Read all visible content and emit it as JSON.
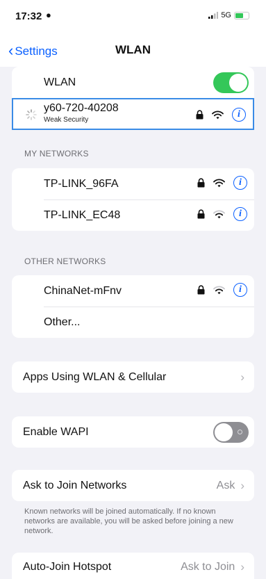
{
  "status": {
    "time": "17:32",
    "network": "5G"
  },
  "nav": {
    "back_label": "Settings",
    "title": "WLAN"
  },
  "wlan": {
    "label": "WLAN",
    "enabled": true
  },
  "joining": {
    "name": "y60-720-40208",
    "subtitle": "Weak Security"
  },
  "my_networks": {
    "header": "MY NETWORKS",
    "items": [
      {
        "name": "TP-LINK_96FA"
      },
      {
        "name": "TP-LINK_EC48"
      }
    ]
  },
  "other_networks": {
    "header": "OTHER NETWORKS",
    "items": [
      {
        "name": "ChinaNet-mFnv"
      }
    ],
    "other_label": "Other..."
  },
  "apps_using": {
    "label": "Apps Using WLAN & Cellular"
  },
  "wapi": {
    "label": "Enable WAPI",
    "enabled": false
  },
  "ask_to_join": {
    "label": "Ask to Join Networks",
    "value": "Ask",
    "footer": "Known networks will be joined automatically. If no known networks are available, you will be asked before joining a new network."
  },
  "auto_join_hotspot": {
    "label": "Auto-Join Hotspot",
    "value": "Ask to Join"
  },
  "colors": {
    "accent": "#0a60ff",
    "toggle_on": "#34c759",
    "toggle_off": "#8e8e93",
    "background": "#f2f2f7"
  },
  "icons": [
    "person-icon",
    "signal-icon",
    "battery-icon",
    "back-chevron-icon",
    "lock-icon",
    "wifi-icon",
    "info-icon",
    "chevron-right-icon",
    "spinner-icon"
  ]
}
